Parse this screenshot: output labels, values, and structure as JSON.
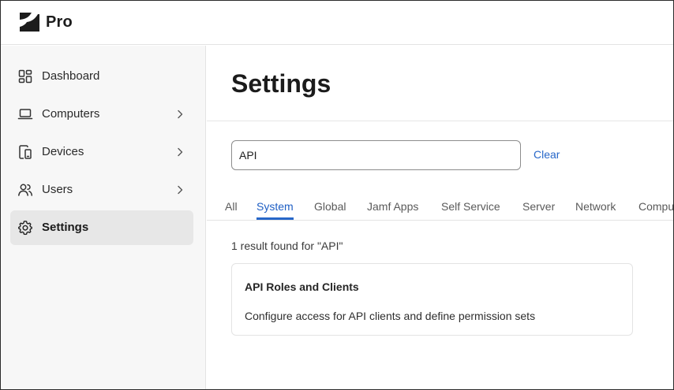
{
  "header": {
    "brand": "Pro",
    "logo_icon": "jamf-logo-icon"
  },
  "sidebar": {
    "items": [
      {
        "label": "Dashboard",
        "icon": "dashboard-grid-icon",
        "has_chevron": false,
        "active": false
      },
      {
        "label": "Computers",
        "icon": "laptop-icon",
        "has_chevron": true,
        "active": false
      },
      {
        "label": "Devices",
        "icon": "devices-icon",
        "has_chevron": true,
        "active": false
      },
      {
        "label": "Users",
        "icon": "users-icon",
        "has_chevron": true,
        "active": false
      },
      {
        "label": "Settings",
        "icon": "gear-icon",
        "has_chevron": false,
        "active": true
      }
    ]
  },
  "main": {
    "title": "Settings",
    "search": {
      "value": "API",
      "clear_label": "Clear"
    },
    "tabs": [
      {
        "label": "All",
        "active": false
      },
      {
        "label": "System",
        "active": true
      },
      {
        "label": "Global",
        "active": false
      },
      {
        "label": "Jamf Apps",
        "active": false
      },
      {
        "label": "Self Service",
        "active": false
      },
      {
        "label": "Server",
        "active": false
      },
      {
        "label": "Network",
        "active": false
      },
      {
        "label": "Computer",
        "active": false
      }
    ],
    "results_count": "1 result found for \"API\"",
    "results": [
      {
        "title": "API Roles and Clients",
        "description": "Configure access for API clients and define permission sets"
      }
    ]
  },
  "colors": {
    "accent": "#2767c9",
    "sidebar_bg": "#f7f7f7",
    "active_item_bg": "#e7e7e7"
  }
}
